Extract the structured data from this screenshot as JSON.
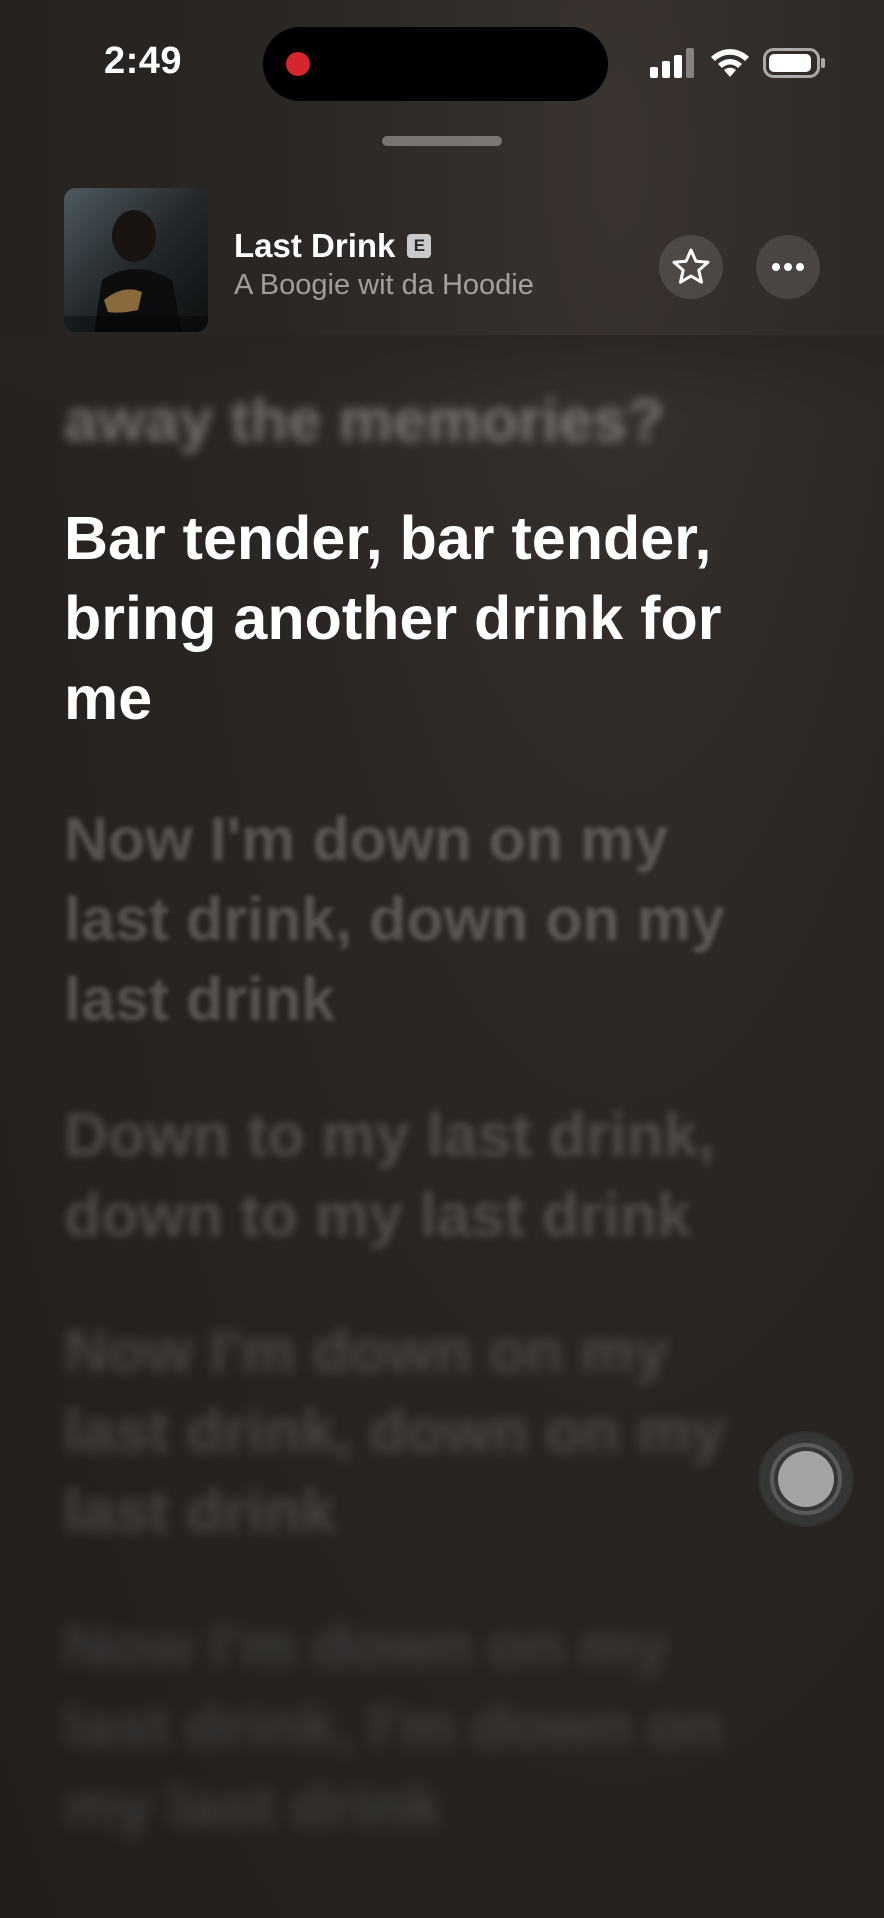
{
  "status_bar": {
    "time": "2:49",
    "recording": true,
    "signal_icon": "cellular-signal-icon",
    "wifi_icon": "wifi-icon",
    "battery_icon": "battery-icon"
  },
  "now_playing": {
    "title": "Last Drink",
    "explicit_badge": "E",
    "artist": "A Boogie wit da Hoodie",
    "favorite_icon": "star-icon",
    "more_icon": "ellipsis-icon"
  },
  "lyrics": {
    "previous": "away the memories?",
    "active": "Bar tender, bar tender, bring another drink for me",
    "upcoming": [
      "Now I'm down on my last drink, down on my last drink",
      "Down to my last drink, down to my last drink",
      "Now I'm down on my last drink, down on my last drink",
      "Now I'm down on my last drink, I'm down on my last drink"
    ]
  },
  "colors": {
    "background": "#2a2623",
    "active_lyric": "#ffffff",
    "record_dot": "#d6262c"
  }
}
